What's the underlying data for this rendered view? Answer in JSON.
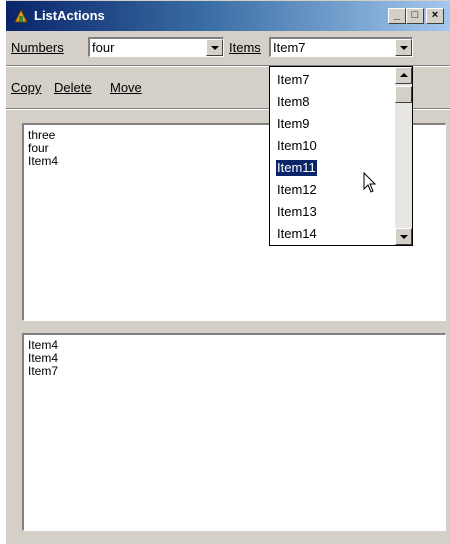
{
  "window": {
    "title": "ListActions",
    "minimize_symbol": "_",
    "maximize_symbol": "□",
    "close_symbol": "×"
  },
  "toolbar": {
    "numbers_label": "Numbers",
    "numbers_value": "four",
    "items_label": "Items",
    "items_value": "Item7"
  },
  "actions": {
    "copy": "Copy",
    "delete": "Delete",
    "move": "Move"
  },
  "top_list": [
    "three",
    "four",
    "Item4"
  ],
  "bottom_list": [
    "Item4",
    "Item4",
    "Item7"
  ],
  "dropdown": {
    "options": [
      "Item7",
      "Item8",
      "Item9",
      "Item10",
      "Item11",
      "Item12",
      "Item13",
      "Item14"
    ],
    "selected": "Item11"
  },
  "icons": {
    "app": "app-icon",
    "cursor": "mouse-pointer-icon"
  },
  "colors": {
    "title_start": "#0a246a",
    "title_end": "#a6caf0",
    "face": "#d4d0c8",
    "selection": "#0a246a"
  }
}
